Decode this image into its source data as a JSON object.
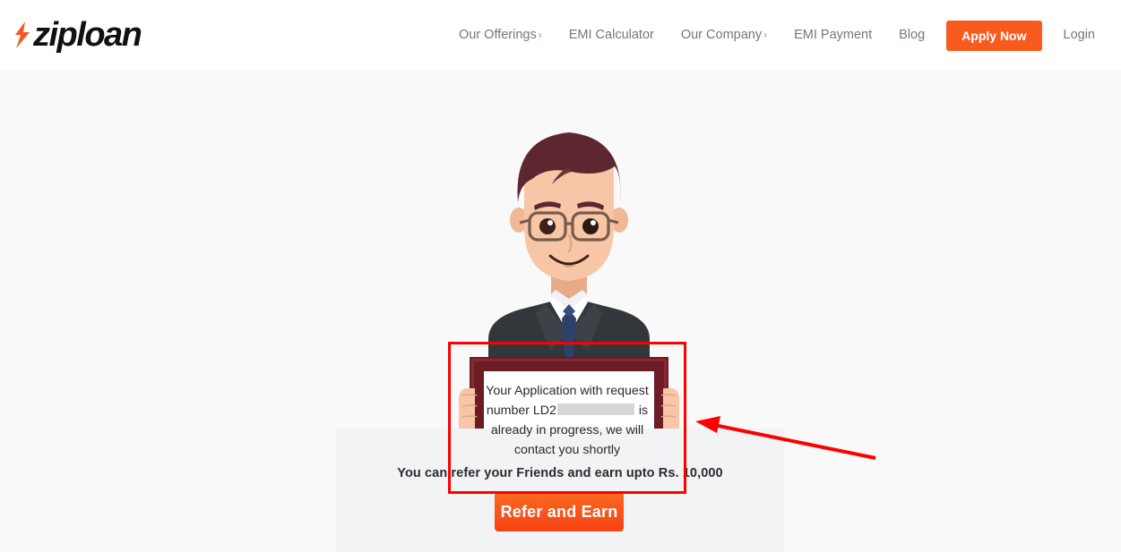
{
  "header": {
    "logo": {
      "text": "ziploan",
      "bolt_icon": "lightning-bolt-icon",
      "bolt_color": "#f15a22"
    },
    "nav": [
      {
        "label": "Our Offerings",
        "caret": "›",
        "has_dropdown": true
      },
      {
        "label": "EMI Calculator",
        "caret": "",
        "has_dropdown": false
      },
      {
        "label": "Our Company",
        "caret": "›",
        "has_dropdown": true
      },
      {
        "label": "EMI Payment",
        "caret": "",
        "has_dropdown": false
      },
      {
        "label": "Blog",
        "caret": "",
        "has_dropdown": false
      }
    ],
    "apply_button": {
      "label": "Apply Now",
      "color": "#f95b1f"
    },
    "login": {
      "label": "Login"
    }
  },
  "main": {
    "illustration": {
      "name": "man-holding-sign-illustration",
      "hair_color": "#5d2730",
      "skin_color": "#f5c3a4",
      "suit_color": "#33363b",
      "tie_color": "#2c4268",
      "sign_frame_color": "#6b1c24"
    },
    "sign": {
      "line1": "Your Application with request",
      "line2_before": "number LD2",
      "line2_redacted": "",
      "line2_after": " is",
      "line3": "already in progress, we will",
      "line4": "contact you shortly",
      "full_text": "Your Application with request number LD2████████ is already in progress, we will contact you shortly"
    },
    "referral": {
      "text": "You can refer your Friends and earn upto Rs. 10,000",
      "button_label": "Refer and Earn",
      "panel_color": "#f2f3f4"
    }
  },
  "annotations": {
    "highlight_rect": {
      "name": "red-highlight-rectangle",
      "color": "#fe0000"
    },
    "pointer_arrow": {
      "name": "red-pointer-arrow",
      "color": "#fe0000",
      "direction": "left"
    }
  },
  "colors": {
    "page_background": "#f9f9f9",
    "header_background": "#ffffff",
    "accent_orange": "#f95b1f",
    "nav_text": "#7b7672"
  }
}
